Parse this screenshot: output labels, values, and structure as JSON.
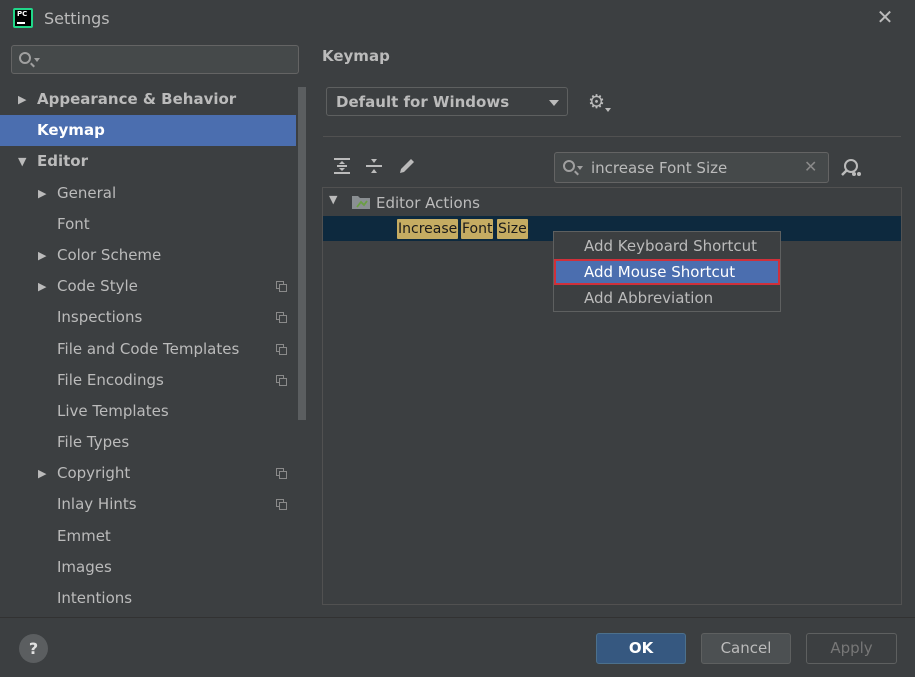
{
  "window": {
    "title": "Settings",
    "app_icon_text": "PC"
  },
  "sidebar": {
    "search_placeholder": "",
    "items": [
      {
        "label": "Appearance & Behavior",
        "level": 0,
        "arrow": "▶",
        "bold": true,
        "selected": false,
        "copy": false
      },
      {
        "label": "Keymap",
        "level": 0,
        "arrow": "",
        "bold": true,
        "selected": true,
        "copy": false
      },
      {
        "label": "Editor",
        "level": 0,
        "arrow": "▼",
        "bold": true,
        "selected": false,
        "copy": false
      },
      {
        "label": "General",
        "level": 1,
        "arrow": "▶",
        "bold": false,
        "selected": false,
        "copy": false
      },
      {
        "label": "Font",
        "level": 1,
        "arrow": "",
        "bold": false,
        "selected": false,
        "copy": false
      },
      {
        "label": "Color Scheme",
        "level": 1,
        "arrow": "▶",
        "bold": false,
        "selected": false,
        "copy": false
      },
      {
        "label": "Code Style",
        "level": 1,
        "arrow": "▶",
        "bold": false,
        "selected": false,
        "copy": true
      },
      {
        "label": "Inspections",
        "level": 1,
        "arrow": "",
        "bold": false,
        "selected": false,
        "copy": true
      },
      {
        "label": "File and Code Templates",
        "level": 1,
        "arrow": "",
        "bold": false,
        "selected": false,
        "copy": true
      },
      {
        "label": "File Encodings",
        "level": 1,
        "arrow": "",
        "bold": false,
        "selected": false,
        "copy": true
      },
      {
        "label": "Live Templates",
        "level": 1,
        "arrow": "",
        "bold": false,
        "selected": false,
        "copy": false
      },
      {
        "label": "File Types",
        "level": 1,
        "arrow": "",
        "bold": false,
        "selected": false,
        "copy": false
      },
      {
        "label": "Copyright",
        "level": 1,
        "arrow": "▶",
        "bold": false,
        "selected": false,
        "copy": true
      },
      {
        "label": "Inlay Hints",
        "level": 1,
        "arrow": "",
        "bold": false,
        "selected": false,
        "copy": true
      },
      {
        "label": "Emmet",
        "level": 1,
        "arrow": "",
        "bold": false,
        "selected": false,
        "copy": false
      },
      {
        "label": "Images",
        "level": 1,
        "arrow": "",
        "bold": false,
        "selected": false,
        "copy": false
      },
      {
        "label": "Intentions",
        "level": 1,
        "arrow": "",
        "bold": false,
        "selected": false,
        "copy": false
      }
    ]
  },
  "main": {
    "title": "Keymap",
    "keymap_select": "Default for Windows",
    "filter_value": "increase Font Size",
    "tree": {
      "group_label": "Editor Actions",
      "action_words": [
        "Increase",
        "Font",
        "Size"
      ]
    },
    "context_menu": [
      {
        "label": "Add Keyboard Shortcut",
        "selected": false
      },
      {
        "label": "Add Mouse Shortcut",
        "selected": true
      },
      {
        "label": "Add Abbreviation",
        "selected": false
      }
    ]
  },
  "footer": {
    "help_label": "?",
    "ok_label": "OK",
    "cancel_label": "Cancel",
    "apply_label": "Apply"
  },
  "colors": {
    "background": "#3c3f41",
    "selection": "#4b6eaf",
    "highlight": "#c5ac62",
    "row_selected": "#0d293e",
    "menu_outline": "#d0303a"
  }
}
